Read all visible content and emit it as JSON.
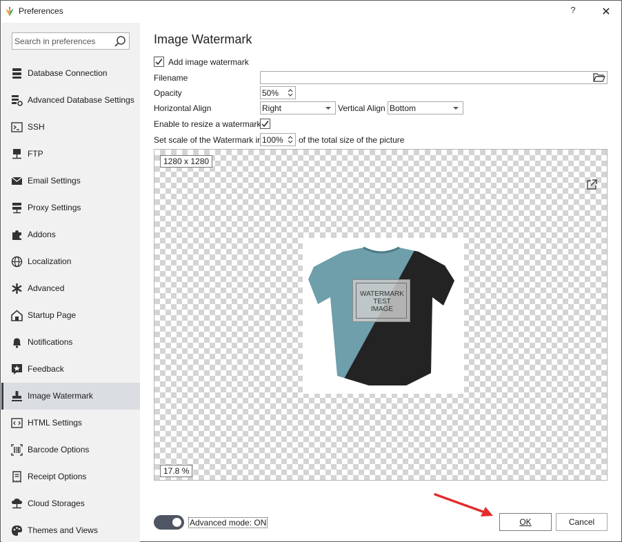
{
  "window": {
    "title": "Preferences",
    "help_label": "?",
    "close_label": "✕"
  },
  "sidebar": {
    "search_placeholder": "Search in preferences",
    "items": [
      {
        "label": "Database Connection",
        "icon": "database-icon"
      },
      {
        "label": "Advanced Database Settings",
        "icon": "database-settings-icon"
      },
      {
        "label": "SSH",
        "icon": "terminal-icon"
      },
      {
        "label": "FTP",
        "icon": "ftp-icon"
      },
      {
        "label": "Email Settings",
        "icon": "envelope-icon"
      },
      {
        "label": "Proxy Settings",
        "icon": "proxy-icon"
      },
      {
        "label": "Addons",
        "icon": "puzzle-icon"
      },
      {
        "label": "Localization",
        "icon": "globe-icon"
      },
      {
        "label": "Advanced",
        "icon": "asterisk-icon"
      },
      {
        "label": "Startup Page",
        "icon": "home-icon"
      },
      {
        "label": "Notifications",
        "icon": "bell-icon"
      },
      {
        "label": "Feedback",
        "icon": "star-comment-icon"
      },
      {
        "label": "Image Watermark",
        "icon": "stamp-icon"
      },
      {
        "label": "HTML Settings",
        "icon": "html-icon"
      },
      {
        "label": "Barcode Options",
        "icon": "barcode-icon"
      },
      {
        "label": "Receipt Options",
        "icon": "receipt-icon"
      },
      {
        "label": "Cloud Storages",
        "icon": "cloud-network-icon"
      },
      {
        "label": "Themes and Views",
        "icon": "palette-icon"
      }
    ],
    "active_index": 12
  },
  "main": {
    "title": "Image Watermark",
    "add_watermark_label": "Add image watermark",
    "add_watermark_checked": true,
    "filename_label": "Filename",
    "filename_value": "",
    "opacity_label": "Opacity",
    "opacity_value": "50%",
    "h_align_label": "Horizontal Align",
    "h_align_value": "Right",
    "v_align_label": "Vertical Align",
    "v_align_value": "Bottom",
    "resize_label": "Enable to resize a watermark",
    "resize_checked": true,
    "scale_label": "Set scale of the Watermark in",
    "scale_value": "100%",
    "scale_suffix": "of the total size of the picture",
    "preview": {
      "dimensions": "1280 x 1280",
      "zoom": "17.8 %",
      "watermark_text": "WATERMARK\nTEST\nIMAGE",
      "colors": {
        "shirt_teal": "#6e9fab",
        "shirt_black": "#232323"
      }
    }
  },
  "footer": {
    "advanced_mode_label": "Advanced mode: ON",
    "advanced_mode_on": true,
    "ok_label": "OK",
    "cancel_label": "Cancel"
  },
  "colors": {
    "accent_arrow": "#e32c2c",
    "sidebar_bg": "#f1f1f1",
    "active_bg": "#dadde2"
  }
}
